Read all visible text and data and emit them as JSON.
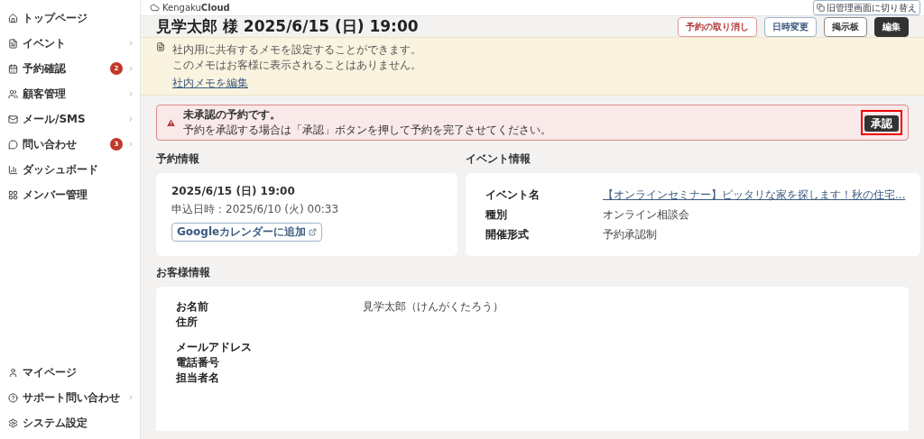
{
  "sidebar": {
    "items": [
      {
        "label": "トップページ",
        "has_submenu": false
      },
      {
        "label": "イベント",
        "has_submenu": true
      },
      {
        "label": "予約確認",
        "badge": "2",
        "has_submenu": true
      },
      {
        "label": "顧客管理",
        "has_submenu": true
      },
      {
        "label": "メール/SMS",
        "has_submenu": true
      },
      {
        "label": "問い合わせ",
        "badge": "3",
        "has_submenu": true
      },
      {
        "label": "ダッシュボード",
        "has_submenu": false
      },
      {
        "label": "メンバー管理",
        "has_submenu": false
      }
    ],
    "bottom_items": [
      {
        "label": "マイページ",
        "has_submenu": false
      },
      {
        "label": "サポート問い合わせ",
        "has_submenu": true
      },
      {
        "label": "システム設定",
        "has_submenu": false
      }
    ]
  },
  "topbar": {
    "logo": "Kengaku**Cloud**",
    "switch_button": "旧管理画面に切り替え"
  },
  "header": {
    "title": "見学太郎 様 2025/6/15 (日) 19:00",
    "buttons": [
      {
        "label": "予約の取り消し",
        "kind": "danger"
      },
      {
        "label": "日時変更",
        "kind": "info"
      },
      {
        "label": "掲示板",
        "kind": "outline"
      },
      {
        "label": "編集",
        "kind": "primary"
      }
    ]
  },
  "memo": {
    "lines": [
      "社内用に共有するメモを設定することができます。",
      "このメモはお客様に表示されることはありません。"
    ],
    "link": "社内メモを編集"
  },
  "alert": {
    "title": "未承認の予約です。",
    "message": "予約を承認する場合は「承認」ボタンを押して予約を完了させてください。",
    "button": {
      "label": "承認",
      "highlighted": true
    }
  },
  "reservation": {
    "heading": "予約情報",
    "date": "2025/6/15 (日) 19:00",
    "applied": "申込日時：2025/6/10 (火) 00:33",
    "calendar_button": "Googleカレンダーに追加"
  },
  "event": {
    "heading": "イベント情報",
    "rows": [
      {
        "label": "イベント名",
        "value": "【オンラインセミナー】ピッタリな家を探します！秋の住宅...",
        "kind": "link"
      },
      {
        "label": "種別",
        "value": "オンライン相談会",
        "kind": "text"
      },
      {
        "label": "開催形式",
        "value": "予約承認制",
        "kind": "text"
      }
    ]
  },
  "customer": {
    "heading": "お客様情報",
    "rows": [
      {
        "label": "お名前",
        "value": "見学太郎（けんがくたろう）",
        "tall": false
      },
      {
        "label": "住所",
        "tall": true
      },
      {
        "label": "メールアドレス",
        "tall": false
      },
      {
        "label": "電話番号",
        "tall": false
      },
      {
        "label": "担当者名",
        "tall": false
      }
    ]
  }
}
